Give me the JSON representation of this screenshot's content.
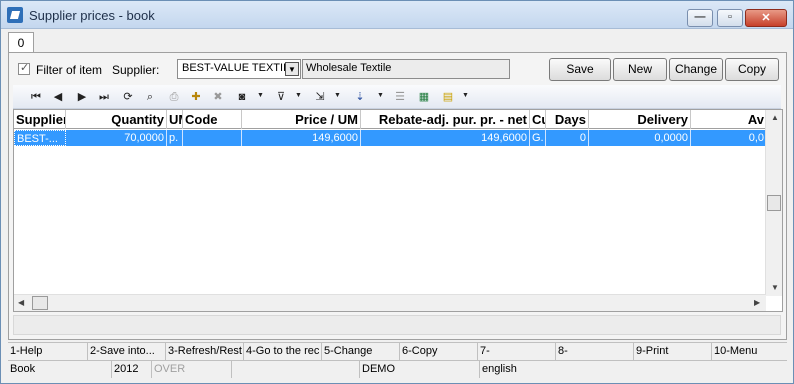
{
  "window": {
    "title": "Supplier prices - book"
  },
  "tabs": [
    "0"
  ],
  "filter": {
    "checkbox_label": "Filter of item",
    "supplier_label": "Supplier:",
    "supplier_value": "BEST-VALUE TEXTILE",
    "supplier_name": "Wholesale Textile"
  },
  "buttons": {
    "save_into": "Save into...",
    "new": "New",
    "change": "Change",
    "copy": "Copy"
  },
  "toolbar_icons": [
    "first-record-icon",
    "prev-record-icon",
    "next-record-icon",
    "last-record-icon",
    "refresh-icon",
    "find-icon",
    "print-icon",
    "add-item-icon",
    "remove-item-icon",
    "camera-icon",
    "filter-icon",
    "export-icon",
    "sort-az-icon",
    "columns-icon",
    "excel-icon",
    "notes-icon"
  ],
  "grid": {
    "columns": [
      "Supplier",
      "Quantity",
      "UM",
      "Code",
      "Price / UM",
      "Rebate-adj. pur. pr. - net",
      "Cu",
      "Days",
      "Delivery",
      "Av"
    ],
    "rows": [
      {
        "supplier": "BEST-...",
        "quantity": "70,0000",
        "um": "p.",
        "code": "",
        "price": "149,6000",
        "rebate": "149,6000",
        "cu": "G.",
        "days": "0",
        "delivery": "0,0000",
        "av": "0,0"
      }
    ]
  },
  "function_keys": [
    "1-Help",
    "2-Save into...",
    "3-Refresh/Rest",
    "4-Go to the rec",
    "5-Change",
    "6-Copy",
    "7-",
    "8-",
    "9-Print",
    "10-Menu"
  ],
  "status": {
    "book": "Book",
    "year": "2012",
    "mode": "OVER",
    "db": "DEMO",
    "lang": "english"
  },
  "colors": {
    "selection": "#3399ff",
    "titlebar": "#c4d7ee",
    "close_button": "#c7402a"
  }
}
